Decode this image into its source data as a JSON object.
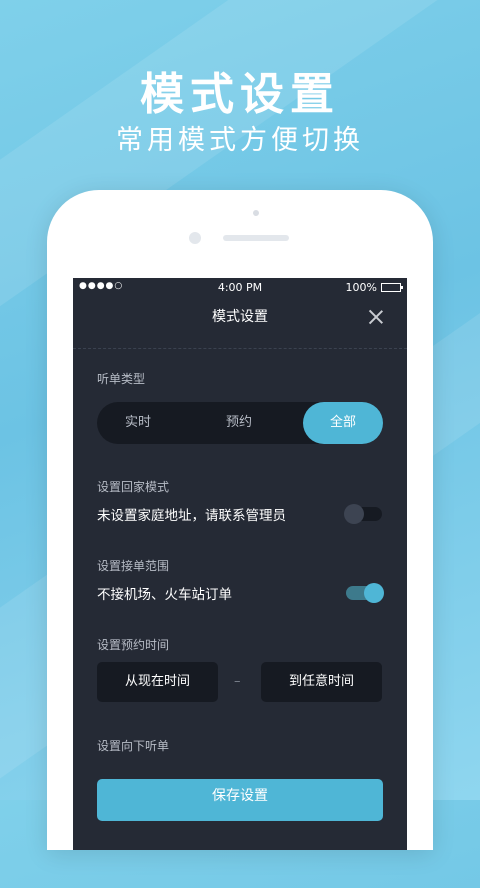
{
  "hero": {
    "title": "模式设置",
    "subtitle": "常用模式方便切换"
  },
  "status_bar": {
    "signal": "●●●●○",
    "time": "4:00 PM",
    "battery": "100%"
  },
  "nav": {
    "title": "模式设置"
  },
  "order_type": {
    "label": "听单类型",
    "options": [
      "实时",
      "预约",
      "全部"
    ],
    "selected": "全部"
  },
  "home_mode": {
    "label": "设置回家模式",
    "text": "未设置家庭地址，请联系管理员",
    "enabled": false
  },
  "order_range": {
    "label": "设置接单范围",
    "text": "不接机场、火车站订单",
    "enabled": true
  },
  "booking_time": {
    "label": "设置预约时间",
    "from": "从现在时间",
    "separator": "–",
    "to": "到任意时间"
  },
  "down_order": {
    "label": "设置向下听单"
  },
  "save": {
    "label": "保存设置"
  },
  "colors": {
    "accent": "#4fb6d6",
    "screen_bg": "#252a35",
    "control_bg": "#161a22"
  }
}
